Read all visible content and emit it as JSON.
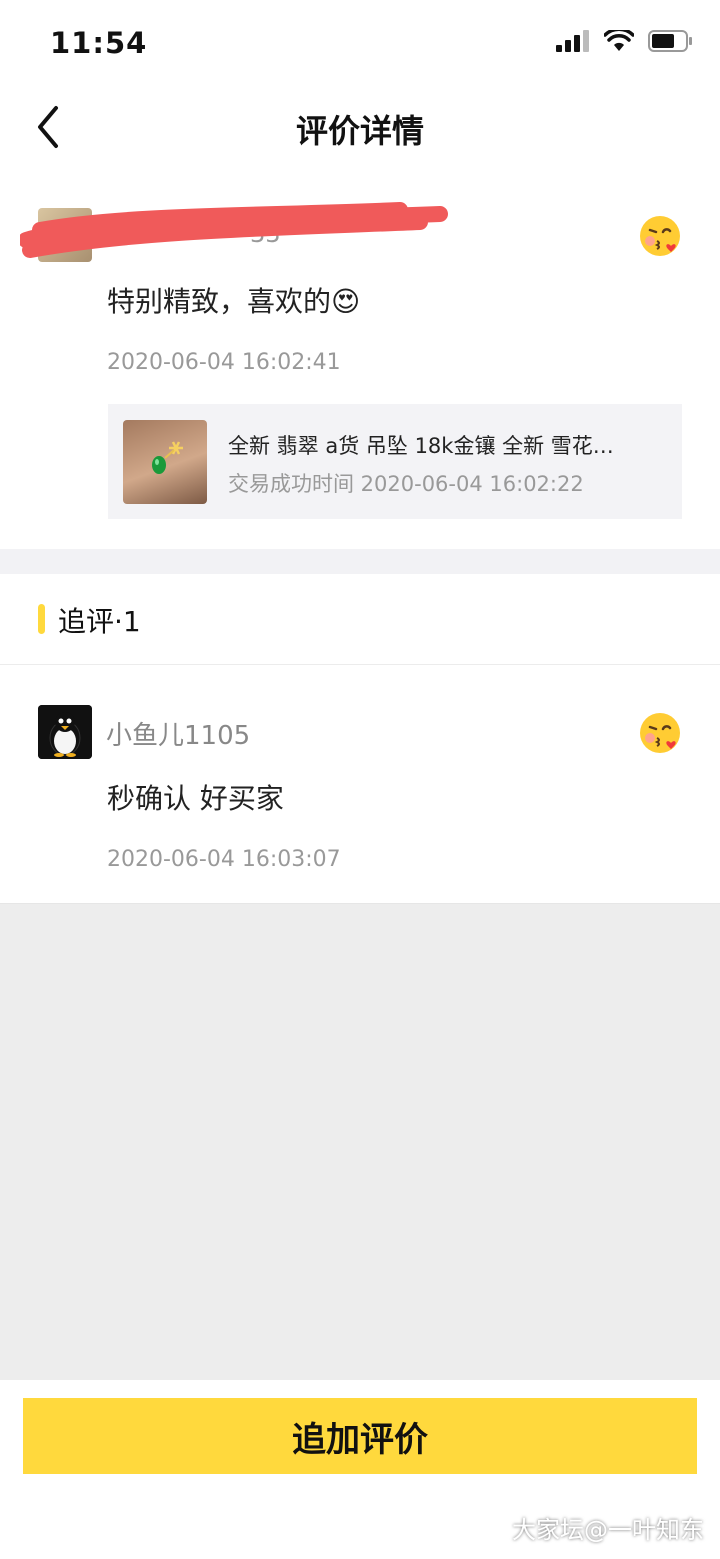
{
  "status_bar": {
    "time": "11:54"
  },
  "nav": {
    "title": "评价详情"
  },
  "review": {
    "username": "33",
    "comment": "特别精致，喜欢的😍",
    "date": "2020-06-04 16:02:41",
    "product": {
      "title": "全新 翡翠 a货 吊坠  18k金镶 全新  雪花…",
      "trade_time": "交易成功时间 2020-06-04 16:02:22"
    }
  },
  "followup_section": {
    "title": "追评·1"
  },
  "followup": {
    "username": "小鱼儿1105",
    "comment": "秒确认 好买家",
    "date": "2020-06-04 16:03:07"
  },
  "actions": {
    "add_review_label": "追加评价"
  },
  "watermark": "大家坛@一叶知东",
  "colors": {
    "accent": "#ffd93d",
    "background_grey": "#ededed",
    "redaction": "#f05a5a"
  }
}
